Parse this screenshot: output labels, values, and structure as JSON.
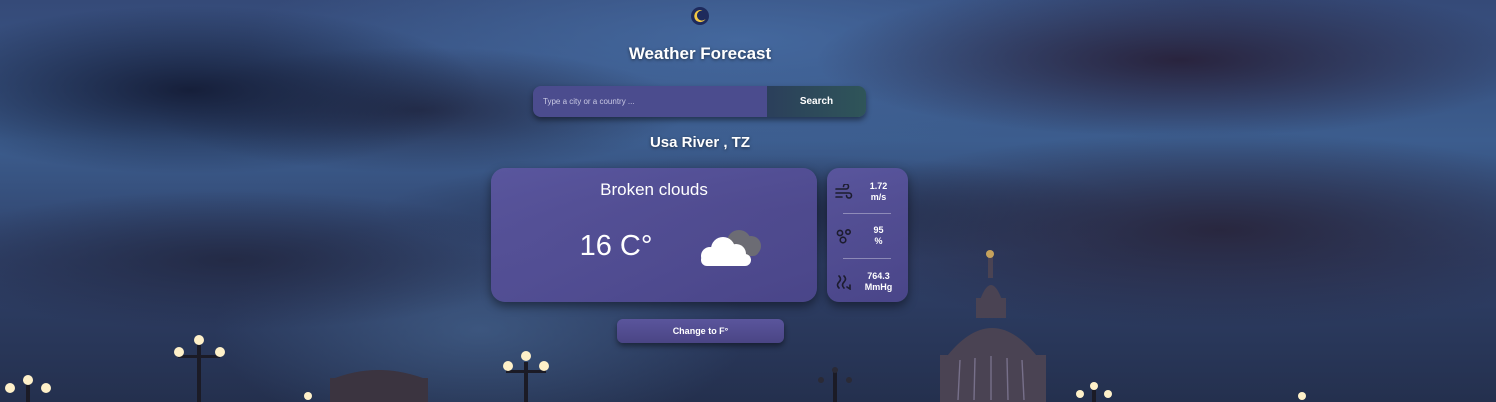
{
  "app": {
    "title": "Weather Forecast",
    "title_icon": "moon-icon"
  },
  "search": {
    "placeholder": "Type a city or a country ...",
    "value": "",
    "button_label": "Search"
  },
  "location": {
    "label": "Usa River , TZ"
  },
  "current": {
    "condition": "Broken clouds",
    "temperature": "16 C°",
    "condition_icon": "broken-clouds-icon"
  },
  "stats": {
    "wind_value": "1.72",
    "wind_unit": "m/s",
    "humidity_value": "95",
    "humidity_unit": "%",
    "pressure_value": "764.3",
    "pressure_unit": "MmHg"
  },
  "units": {
    "toggle_label": "Change to F°"
  },
  "colors": {
    "card": "#5a56a0",
    "search_input": "#4b4c8e",
    "search_button": "#2f5559",
    "moon": "#f2c744"
  }
}
